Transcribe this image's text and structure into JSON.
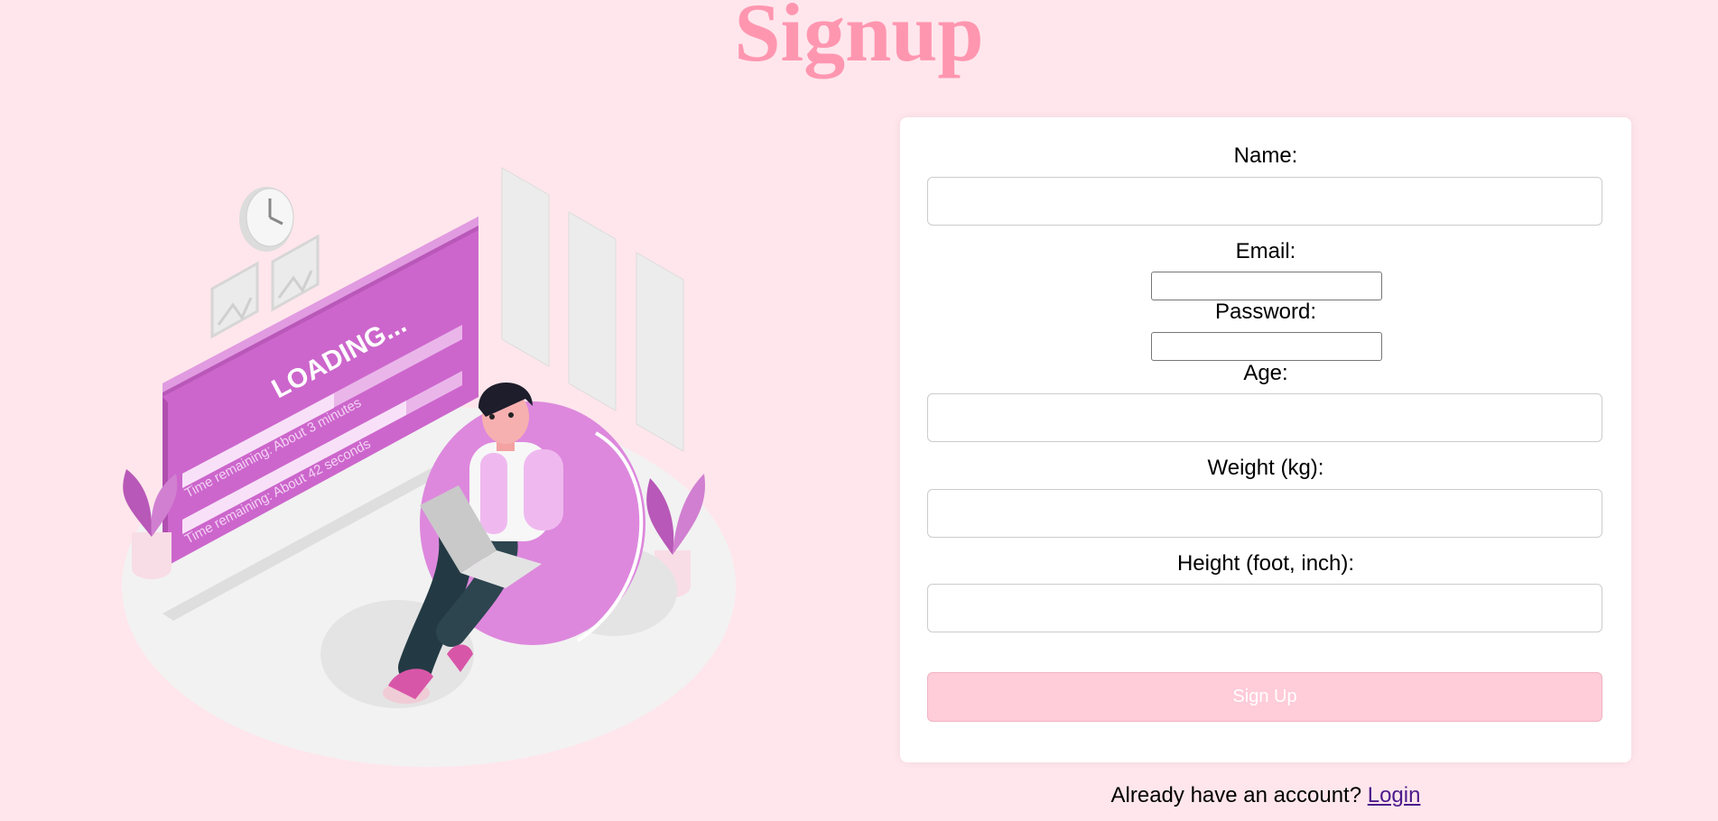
{
  "page": {
    "title": "Signup"
  },
  "illustration": {
    "loading_text": "LOADING...",
    "line1": "Time remaining: About 3 minutes",
    "line2": "Time remaining: About 42 seconds"
  },
  "form": {
    "name_label": "Name:",
    "name_value": "",
    "email_label": "Email:",
    "email_value": "",
    "password_label": "Password:",
    "password_value": "",
    "age_label": "Age:",
    "age_value": "",
    "weight_label": "Weight (kg):",
    "weight_value": "",
    "height_label": "Height (foot, inch):",
    "height_value": "",
    "submit_label": "Sign Up"
  },
  "footer": {
    "prompt": "Already have an account?",
    "login_label": "Login"
  },
  "colors": {
    "background": "#ffe6ec",
    "title": "#ff96b0",
    "button": "#ffccd9",
    "illustration_accent": "#cf69cf"
  }
}
